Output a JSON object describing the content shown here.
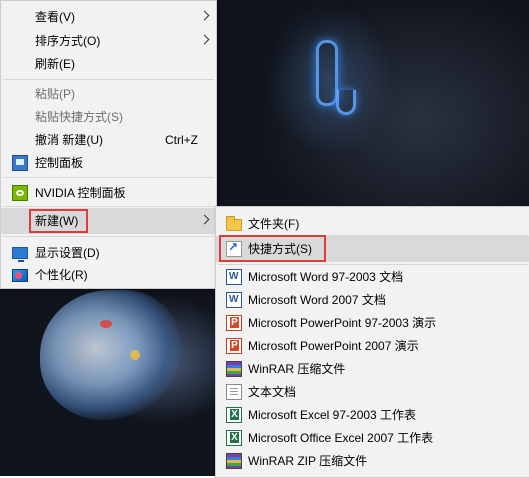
{
  "context_menu": {
    "items": [
      {
        "label": "查看(V)",
        "submenu": true
      },
      {
        "label": "排序方式(O)",
        "submenu": true
      },
      {
        "label": "刷新(E)"
      },
      {
        "label": "粘贴(P)",
        "disabled": true
      },
      {
        "label": "粘贴快捷方式(S)",
        "disabled": true
      },
      {
        "label": "撤消 新建(U)",
        "shortcut": "Ctrl+Z"
      },
      {
        "label": "控制面板",
        "icon": "control-panel-icon"
      },
      {
        "label": "NVIDIA 控制面板",
        "icon": "nvidia-icon"
      },
      {
        "label": "新建(W)",
        "submenu": true,
        "highlighted": true
      },
      {
        "label": "显示设置(D)",
        "icon": "display-settings-icon"
      },
      {
        "label": "个性化(R)",
        "icon": "personalize-icon"
      }
    ]
  },
  "new_submenu": {
    "items": [
      {
        "label": "文件夹(F)",
        "icon": "folder-icon"
      },
      {
        "label": "快捷方式(S)",
        "icon": "shortcut-icon",
        "highlighted": true
      },
      {
        "label": "Microsoft Word 97-2003 文档",
        "icon": "word-icon"
      },
      {
        "label": "Microsoft Word 2007 文档",
        "icon": "word-icon"
      },
      {
        "label": "Microsoft PowerPoint 97-2003 演示",
        "icon": "powerpoint-icon"
      },
      {
        "label": "Microsoft PowerPoint 2007 演示",
        "icon": "powerpoint-icon"
      },
      {
        "label": "WinRAR 压缩文件",
        "icon": "winrar-icon"
      },
      {
        "label": "文本文档",
        "icon": "text-document-icon"
      },
      {
        "label": "Microsoft Excel 97-2003 工作表",
        "icon": "excel-icon"
      },
      {
        "label": "Microsoft Office Excel 2007 工作表",
        "icon": "excel-icon"
      },
      {
        "label": "WinRAR ZIP 压缩文件",
        "icon": "winrar-zip-icon"
      }
    ]
  },
  "colors": {
    "menu_bg": "#f2f2f2",
    "highlight_bg": "#d9d9d9",
    "annotation_red": "#e03a3a",
    "disabled_text": "#6d6d6d"
  }
}
